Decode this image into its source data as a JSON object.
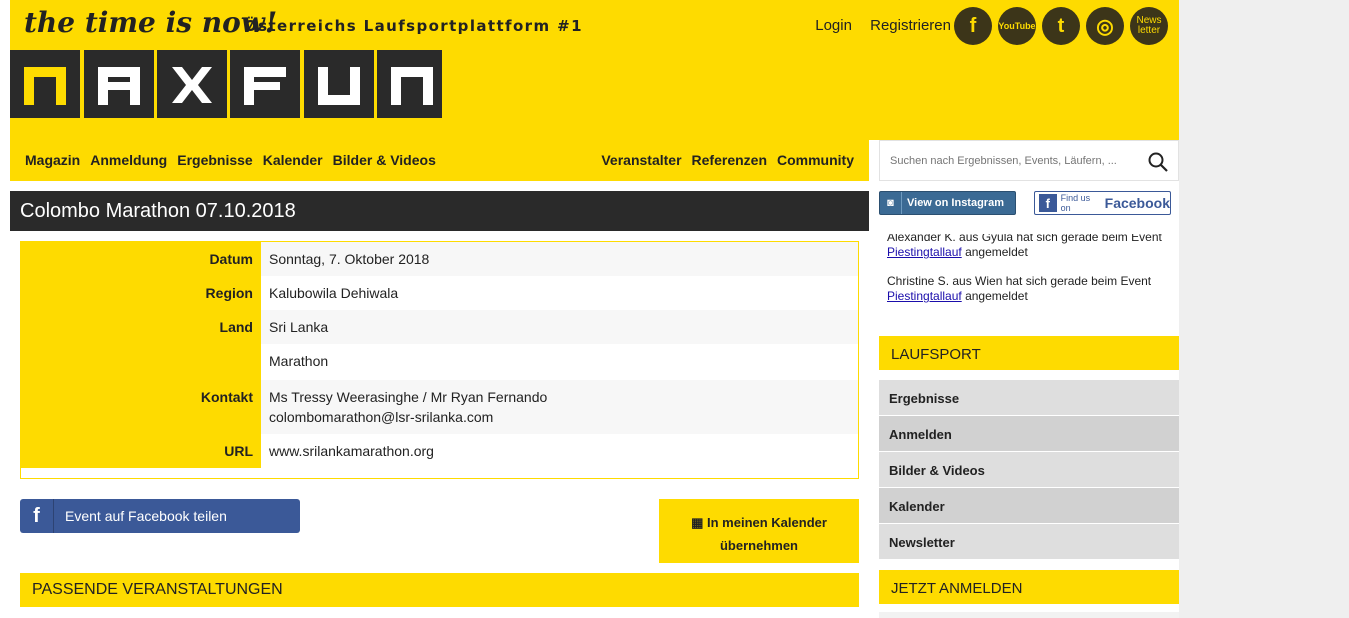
{
  "header": {
    "slogan": "the time is now!",
    "tagline": "Österreichs Laufsportplattform #1",
    "logo_text": "MAXFUN",
    "login": "Login",
    "register": "Registrieren",
    "social": [
      {
        "icon": "facebook-icon",
        "glyph": "f"
      },
      {
        "icon": "youtube-icon",
        "glyph": "YouTube"
      },
      {
        "icon": "twitter-icon",
        "glyph": "t"
      },
      {
        "icon": "instagram-icon",
        "glyph": "◎"
      },
      {
        "icon": "newsletter-icon",
        "glyph": "News letter"
      }
    ]
  },
  "nav": {
    "left": [
      "Magazin",
      "Anmeldung",
      "Ergebnisse",
      "Kalender",
      "Bilder & Videos"
    ],
    "right": [
      "Veranstalter",
      "Referenzen",
      "Community"
    ]
  },
  "search": {
    "placeholder": "Suchen nach Ergebnissen, Events, Läufern, ..."
  },
  "event": {
    "title": "Colombo Marathon 07.10.2018",
    "rows": [
      {
        "label": "Datum",
        "value": "Sonntag, 7. Oktober 2018"
      },
      {
        "label": "Region",
        "value": "Kalubowila Dehiwala"
      },
      {
        "label": "Land",
        "value": "Sri Lanka"
      },
      {
        "label": "",
        "value": "Marathon"
      },
      {
        "label": "Kontakt",
        "value": "Ms Tressy Weerasinghe / Mr Ryan Fernando",
        "value2": "colombomarathon@lsr-srilanka.com"
      },
      {
        "label": "URL",
        "value": "www.srilankamarathon.org"
      }
    ],
    "facebook_share": "Event auf Facebook teilen",
    "calendar_line1": "In meinen Kalender",
    "calendar_line2": "übernehmen",
    "related_heading": "PASSENDE VERANSTALTUNGEN"
  },
  "sidebar": {
    "instagram_btn": "View on Instagram",
    "facebook_btn_prefix": "Find us on",
    "facebook_btn_brand": "Facebook",
    "feed": [
      {
        "text": "Alexander K. aus Gyula hat sich gerade beim Event",
        "link": "Piestingtallauf",
        "suffix": "angemeldet"
      },
      {
        "text": "Christine S. aus Wien hat sich gerade beim Event",
        "link": "Piestingtallauf",
        "suffix": "angemeldet"
      }
    ],
    "laufsport_heading": "LAUFSPORT",
    "links": [
      "Ergebnisse",
      "Anmelden",
      "Bilder & Videos",
      "Kalender",
      "Newsletter"
    ],
    "signup_heading": "JETZT ANMELDEN"
  },
  "colors": {
    "brand_yellow": "#fedb00",
    "dark": "#2a2a2a",
    "facebook": "#3b5998"
  }
}
